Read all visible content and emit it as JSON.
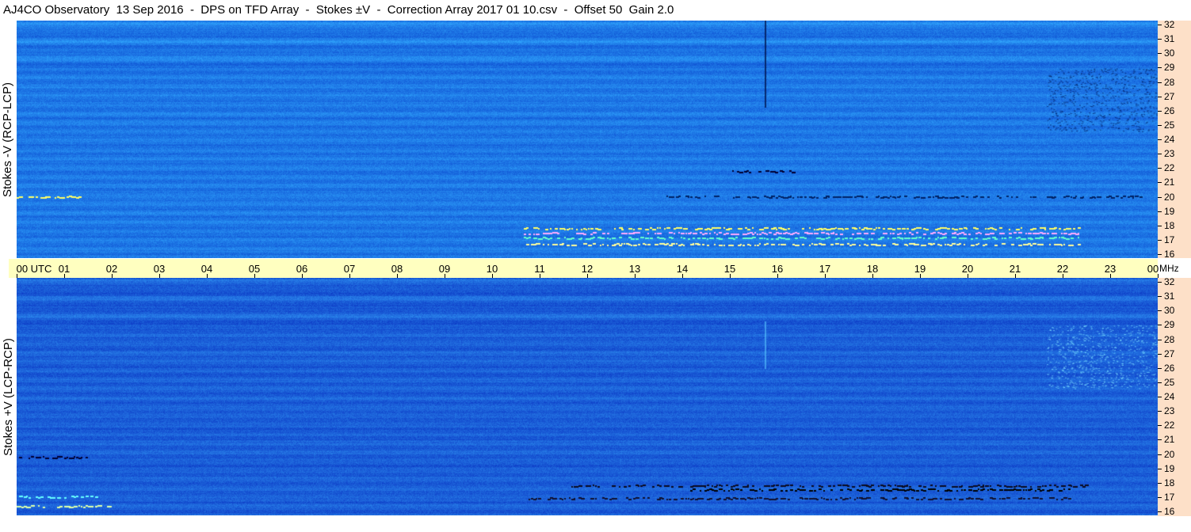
{
  "header": {
    "title": "AJ4CO Observatory  13 Sep 2016  -  DPS on TFD Array  -  Stokes ±V  -  Correction Array 2017 01 10.csv  -  Offset 50  Gain 2.0"
  },
  "panels": [
    {
      "ylabel": "Stokes -V (RCP-LCP)",
      "base_color": "#1e78e6"
    },
    {
      "ylabel": "Stokes +V (LCP-RCP)",
      "base_color": "#1b5fd8"
    }
  ],
  "time_axis": {
    "labels": [
      "00  UTC",
      "01",
      "02",
      "03",
      "04",
      "05",
      "06",
      "07",
      "08",
      "09",
      "10",
      "11",
      "12",
      "13",
      "14",
      "15",
      "16",
      "17",
      "18",
      "19",
      "20",
      "21",
      "22",
      "23",
      "00"
    ],
    "unit": "MHz"
  },
  "freq_axis": {
    "labels": [
      "32",
      "31",
      "30",
      "29",
      "28",
      "27",
      "26",
      "25",
      "24",
      "23",
      "22",
      "21",
      "20",
      "19",
      "18",
      "17",
      "16"
    ]
  },
  "colors": {
    "time_axis_bg": "#ffffc0",
    "freq_axis_bg": "#fde0c8"
  }
}
